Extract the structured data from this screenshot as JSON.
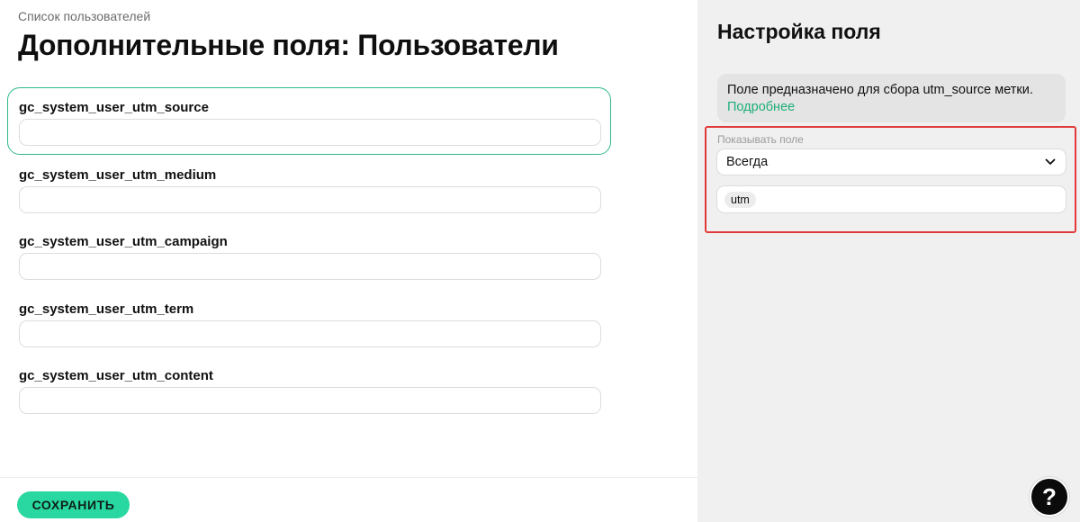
{
  "breadcrumb": "Список пользователей",
  "page_title": "Дополнительные поля: Пользователи",
  "fields": [
    {
      "label": "gc_system_user_utm_source",
      "value": "",
      "active": true
    },
    {
      "label": "gc_system_user_utm_medium",
      "value": ""
    },
    {
      "label": "gc_system_user_utm_campaign",
      "value": ""
    },
    {
      "label": "gc_system_user_utm_term",
      "value": ""
    },
    {
      "label": "gc_system_user_utm_content",
      "value": ""
    }
  ],
  "save_label": "СОХРАНИТЬ",
  "panel": {
    "title": "Настройка поля",
    "info_text": "Поле предназначено для сбора utm_source метки.",
    "info_link": "Подробнее",
    "show_label": "Показывать поле",
    "show_value": "Всегда",
    "tags": [
      "utm"
    ]
  },
  "help_label": "?",
  "colors": {
    "accent": "#28d8a0",
    "active_border": "#2fba86",
    "link": "#1fae7a",
    "highlight": "#e23a3a",
    "panel_bg": "#f0f0f0"
  },
  "icons": {
    "select_arrow": "chevron-down-icon",
    "help": "question-icon"
  }
}
